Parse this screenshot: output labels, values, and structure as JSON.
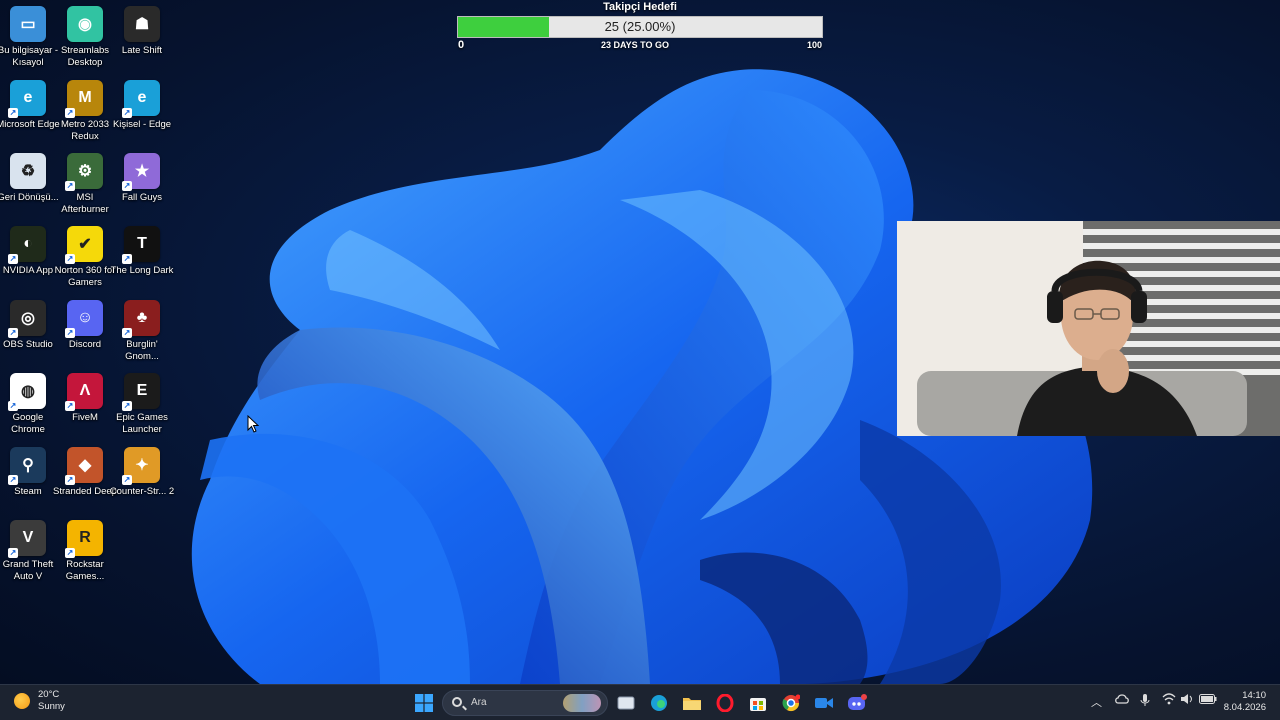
{
  "desktop_icons": [
    {
      "label": "Bu bilgisayar - Kısayol",
      "icon": "monitor-icon",
      "color": "#3a8fd8"
    },
    {
      "label": "Streamlabs Desktop",
      "icon": "streamlabs-icon",
      "color": "#31c3a2"
    },
    {
      "label": "Late Shift",
      "icon": "late-shift-icon",
      "color": "#2a2a2a"
    },
    {
      "label": "Microsoft Edge",
      "icon": "edge-icon",
      "color": "#1aa0d8"
    },
    {
      "label": "Metro 2033 Redux",
      "icon": "metro-icon",
      "color": "#b8860b"
    },
    {
      "label": "Kişisel - Edge",
      "icon": "edge-icon",
      "color": "#1aa0d8"
    },
    {
      "label": "Geri Dönüşü...",
      "icon": "recycle-bin-icon",
      "color": "#d9e3ee"
    },
    {
      "label": "MSI Afterburner",
      "icon": "afterburner-icon",
      "color": "#3a6b3a"
    },
    {
      "label": "Fall Guys",
      "icon": "fall-guys-icon",
      "color": "#8f6ad8"
    },
    {
      "label": "NVIDIA App",
      "icon": "nvidia-icon",
      "color": "#1f2a1a"
    },
    {
      "label": "Norton 360 for Gamers",
      "icon": "norton-icon",
      "color": "#f5d90a"
    },
    {
      "label": "The Long Dark",
      "icon": "long-dark-icon",
      "color": "#111111"
    },
    {
      "label": "OBS Studio",
      "icon": "obs-icon",
      "color": "#2a2a2a"
    },
    {
      "label": "Discord",
      "icon": "discord-icon",
      "color": "#5865f2"
    },
    {
      "label": "Burglin' Gnom...",
      "icon": "burglin-gnomes-icon",
      "color": "#8a1e1e"
    },
    {
      "label": "Google Chrome",
      "icon": "chrome-icon",
      "color": "#ffffff"
    },
    {
      "label": "FiveM",
      "icon": "fivem-icon",
      "color": "#c4163b"
    },
    {
      "label": "Epic Games Launcher",
      "icon": "epic-games-icon",
      "color": "#1b1b1b"
    },
    {
      "label": "Steam",
      "icon": "steam-icon",
      "color": "#1b3a5c"
    },
    {
      "label": "Stranded Deep",
      "icon": "stranded-deep-icon",
      "color": "#c2542a"
    },
    {
      "label": "Counter-Str... 2",
      "icon": "counter-strike-icon",
      "color": "#e09a26"
    },
    {
      "label": "Grand Theft Auto V",
      "icon": "gta-icon",
      "color": "#3b3b3b"
    },
    {
      "label": "Rockstar Games...",
      "icon": "rockstar-icon",
      "color": "#f4b400"
    }
  ],
  "follower_goal": {
    "title": "Takipçi Hedefi",
    "current": 25,
    "progress_text": "25 (25.00%)",
    "progress": 0.25,
    "min_label": "0",
    "max_label": "100",
    "days_left": "23 DAYS TO GO",
    "fill_color": "#3ecf3e"
  },
  "taskbar": {
    "weather_temp": "20°C",
    "weather_condition": "Sunny",
    "search_placeholder": "Ara",
    "time": "14:10",
    "date": "8.04.2026"
  },
  "colors": {
    "accent": "#1a6cf0",
    "taskbar_bg": "#1c2330"
  }
}
